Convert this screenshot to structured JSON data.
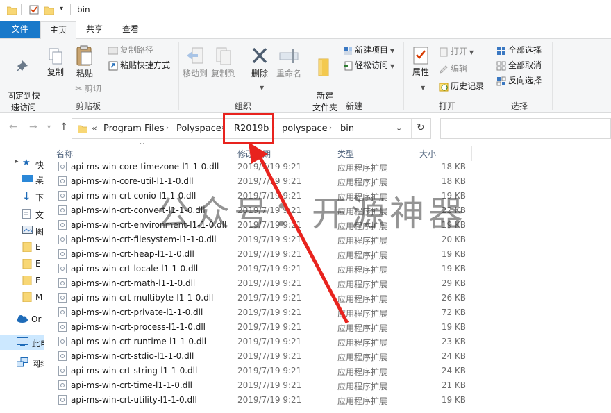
{
  "window": {
    "title": "bin"
  },
  "tabs": [
    {
      "label": "文件"
    },
    {
      "label": "主页"
    },
    {
      "label": "共享"
    },
    {
      "label": "查看"
    }
  ],
  "ribbon": {
    "clipboard": {
      "pin": "固定到快\n速访问",
      "copy": "复制",
      "paste": "粘贴",
      "copy_path": "复制路径",
      "paste_shortcut": "粘贴快捷方式",
      "cut": "剪切",
      "group": "剪贴板"
    },
    "organize": {
      "move_to": "移动到",
      "copy_to": "复制到",
      "delete": "删除",
      "rename": "重命名",
      "group": "组织"
    },
    "new": {
      "new_folder": "新建\n文件夹",
      "new_item": "新建项目",
      "easy_access": "轻松访问",
      "group": "新建"
    },
    "open": {
      "properties": "属性",
      "open": "打开",
      "edit": "编辑",
      "history": "历史记录",
      "group": "打开"
    },
    "select": {
      "select_all": "全部选择",
      "select_none": "全部取消",
      "invert": "反向选择",
      "group": "选择"
    }
  },
  "address": {
    "overflow": "«",
    "crumbs": [
      "Program Files",
      "Polyspace",
      "R2019b",
      "polyspace",
      "bin"
    ]
  },
  "navpane": {
    "items": [
      {
        "label": "快",
        "icon": "star-icon"
      },
      {
        "label": "桌",
        "icon": "desktop-icon"
      },
      {
        "label": "下",
        "icon": "download-icon"
      },
      {
        "label": "文",
        "icon": "document-icon"
      },
      {
        "label": "图",
        "icon": "picture-icon"
      },
      {
        "label": "E",
        "icon": "folder-icon"
      },
      {
        "label": "E",
        "icon": "folder-icon"
      },
      {
        "label": "E",
        "icon": "folder-icon"
      },
      {
        "label": "M",
        "icon": "folder-icon"
      },
      {
        "label": "Or",
        "icon": "cloud-icon"
      },
      {
        "label": "此电",
        "icon": "computer-icon"
      },
      {
        "label": "网络",
        "icon": "network-icon"
      }
    ]
  },
  "columns": {
    "name": "名称",
    "date": "修改日期",
    "type": "类型",
    "size": "大小"
  },
  "files": [
    {
      "name": "api-ms-win-core-timezone-l1-1-0.dll",
      "date": "2019/7/19 9:21",
      "type": "应用程序扩展",
      "size": "18 KB"
    },
    {
      "name": "api-ms-win-core-util-l1-1-0.dll",
      "date": "2019/7/19 9:21",
      "type": "应用程序扩展",
      "size": "18 KB"
    },
    {
      "name": "api-ms-win-crt-conio-l1-1-0.dll",
      "date": "2019/7/19 9:21",
      "type": "应用程序扩展",
      "size": "19 KB"
    },
    {
      "name": "api-ms-win-crt-convert-l1-1-0.dll",
      "date": "2019/7/19 9:21",
      "type": "应用程序扩展",
      "size": "22 KB"
    },
    {
      "name": "api-ms-win-crt-environment-l1-1-0.dll",
      "date": "2019/7/19 9:21",
      "type": "应用程序扩展",
      "size": "19 KB"
    },
    {
      "name": "api-ms-win-crt-filesystem-l1-1-0.dll",
      "date": "2019/7/19 9:21",
      "type": "应用程序扩展",
      "size": "20 KB"
    },
    {
      "name": "api-ms-win-crt-heap-l1-1-0.dll",
      "date": "2019/7/19 9:21",
      "type": "应用程序扩展",
      "size": "19 KB"
    },
    {
      "name": "api-ms-win-crt-locale-l1-1-0.dll",
      "date": "2019/7/19 9:21",
      "type": "应用程序扩展",
      "size": "19 KB"
    },
    {
      "name": "api-ms-win-crt-math-l1-1-0.dll",
      "date": "2019/7/19 9:21",
      "type": "应用程序扩展",
      "size": "29 KB"
    },
    {
      "name": "api-ms-win-crt-multibyte-l1-1-0.dll",
      "date": "2019/7/19 9:21",
      "type": "应用程序扩展",
      "size": "26 KB"
    },
    {
      "name": "api-ms-win-crt-private-l1-1-0.dll",
      "date": "2019/7/19 9:21",
      "type": "应用程序扩展",
      "size": "72 KB"
    },
    {
      "name": "api-ms-win-crt-process-l1-1-0.dll",
      "date": "2019/7/19 9:21",
      "type": "应用程序扩展",
      "size": "19 KB"
    },
    {
      "name": "api-ms-win-crt-runtime-l1-1-0.dll",
      "date": "2019/7/19 9:21",
      "type": "应用程序扩展",
      "size": "23 KB"
    },
    {
      "name": "api-ms-win-crt-stdio-l1-1-0.dll",
      "date": "2019/7/19 9:21",
      "type": "应用程序扩展",
      "size": "24 KB"
    },
    {
      "name": "api-ms-win-crt-string-l1-1-0.dll",
      "date": "2019/7/19 9:21",
      "type": "应用程序扩展",
      "size": "24 KB"
    },
    {
      "name": "api-ms-win-crt-time-l1-1-0.dll",
      "date": "2019/7/19 9:21",
      "type": "应用程序扩展",
      "size": "21 KB"
    },
    {
      "name": "api-ms-win-crt-utility-l1-1-0.dll",
      "date": "2019/7/19 9:21",
      "type": "应用程序扩展",
      "size": "19 KB"
    }
  ],
  "watermark": "公众号：开源神器",
  "colors": {
    "file_tab": "#1979ca",
    "highlight": "#e8231e",
    "header_text": "#4c607a",
    "selected_nav": "#cce8ff"
  }
}
